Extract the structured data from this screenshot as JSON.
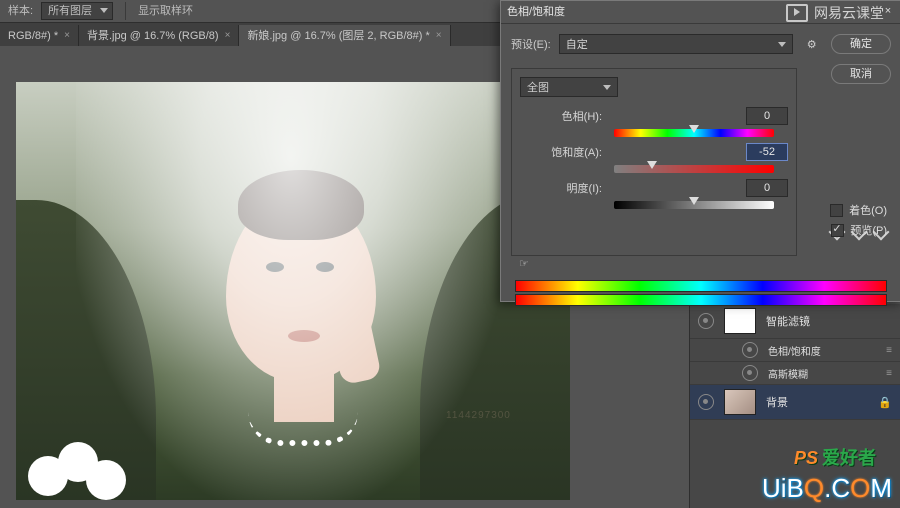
{
  "toolbar": {
    "sample_label": "样本:",
    "sample_value": "所有图层",
    "show_sample_ring": "显示取样环"
  },
  "tabs": [
    {
      "label": "RGB/8#) *",
      "active": false
    },
    {
      "label": "背景.jpg @ 16.7% (RGB/8)",
      "active": false
    },
    {
      "label": "新娘.jpg @ 16.7% (图层 2, RGB/8#) *",
      "active": true
    }
  ],
  "dialog": {
    "title": "色相/饱和度",
    "preset_label": "预设(E):",
    "preset_value": "自定",
    "ok": "确定",
    "cancel": "取消",
    "scope": "全图",
    "sliders": {
      "hue": {
        "label": "色相(H):",
        "value": "0",
        "pos_pct": 50
      },
      "sat": {
        "label": "饱和度(A):",
        "value": "-52",
        "pos_pct": 24
      },
      "lit": {
        "label": "明度(I):",
        "value": "0",
        "pos_pct": 50
      }
    },
    "colorize": {
      "label": "着色(O)",
      "checked": false
    },
    "preview": {
      "label": "预览(P)",
      "checked": true
    }
  },
  "layers": {
    "smart_filters": "智能滤镜",
    "items": [
      {
        "name": "色相/饱和度"
      },
      {
        "name": "高斯模糊"
      }
    ],
    "bg": "背景"
  },
  "watermark_id": "1144297300",
  "branding": {
    "top": "网易云课堂",
    "bottom_cn_prefix": "PS",
    "bottom_cn": "爱好者",
    "bottom_en": "UiBQ.COM"
  }
}
